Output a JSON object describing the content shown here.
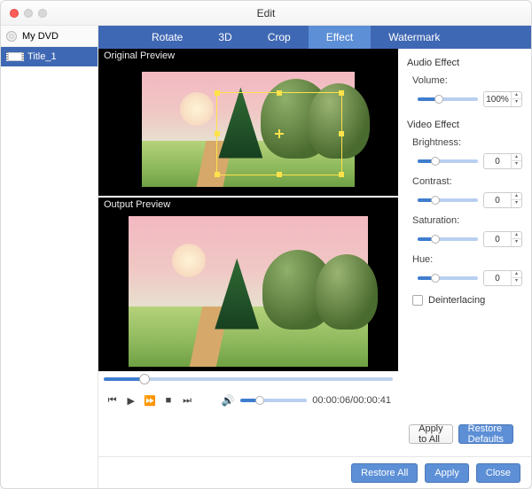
{
  "window": {
    "title": "Edit"
  },
  "sidebar": {
    "root": "My DVD",
    "items": [
      {
        "label": "Title_1"
      }
    ]
  },
  "tabs": {
    "rotate": "Rotate",
    "threeD": "3D",
    "crop": "Crop",
    "effect": "Effect",
    "watermark": "Watermark"
  },
  "preview": {
    "original_label": "Original Preview",
    "output_label": "Output Preview"
  },
  "player": {
    "current": "00:00:06",
    "duration": "00:00:41",
    "seek_pct": 14,
    "volume_pct": 30
  },
  "audio_effect": {
    "heading": "Audio Effect",
    "volume_label": "Volume:",
    "volume_value": "100%",
    "volume_pct": 35
  },
  "video_effect": {
    "heading": "Video Effect",
    "brightness_label": "Brightness:",
    "brightness_value": "0",
    "contrast_label": "Contrast:",
    "contrast_value": "0",
    "saturation_label": "Saturation:",
    "saturation_value": "0",
    "hue_label": "Hue:",
    "hue_value": "0",
    "deinterlacing_label": "Deinterlacing"
  },
  "buttons": {
    "apply_all": "Apply to All",
    "restore_defaults": "Restore Defaults",
    "restore_all": "Restore All",
    "apply": "Apply",
    "close": "Close"
  }
}
